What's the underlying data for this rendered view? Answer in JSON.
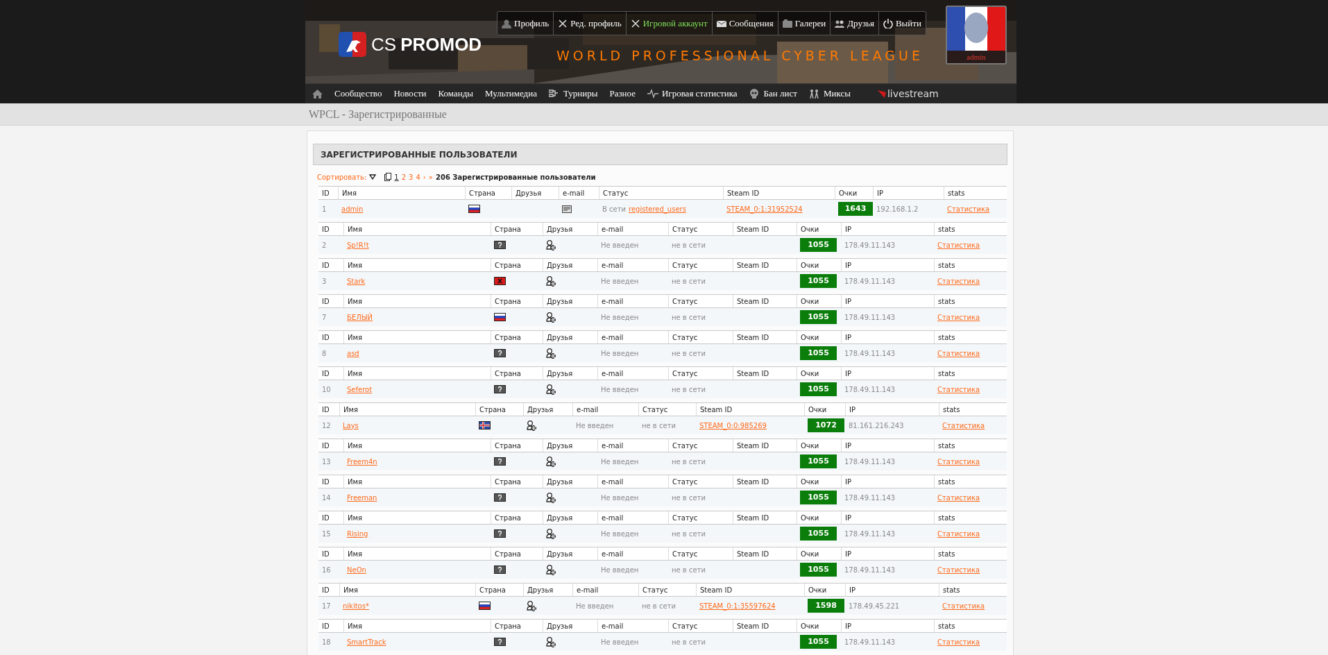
{
  "header": {
    "logo_prefix": "CS",
    "logo_name": "PROMOD",
    "tagline": "WORLD PROFESSIONAL CYBER LEAGUE",
    "avatar_name": "admin",
    "user_menu": [
      {
        "label": "Профиль",
        "selected": false
      },
      {
        "label": "Ред. профиль",
        "selected": false
      },
      {
        "label": "Игровой аккаунт",
        "selected": true
      },
      {
        "label": "Сообщения",
        "selected": false
      },
      {
        "label": "Галереи",
        "selected": false
      },
      {
        "label": "Друзья",
        "selected": false
      },
      {
        "label": "Выйти",
        "selected": false
      }
    ]
  },
  "nav": [
    {
      "kind": "home"
    },
    {
      "kind": "plain",
      "label": "Сообщество"
    },
    {
      "kind": "plain",
      "label": "Новости"
    },
    {
      "kind": "plain",
      "label": "Команды"
    },
    {
      "kind": "plain",
      "label": "Мультимедиа"
    },
    {
      "kind": "iconed",
      "label": "Турниры"
    },
    {
      "kind": "plain",
      "label": "Разное"
    },
    {
      "kind": "iconed",
      "label": "Игровая статистика"
    },
    {
      "kind": "iconed",
      "label": "Бан лист"
    },
    {
      "kind": "iconed",
      "label": "Миксы"
    },
    {
      "kind": "brand",
      "label": "livestream"
    }
  ],
  "breadcrumb": "WPCL - Зарегистрированные",
  "panel_title": "ЗАРЕГИСТРИРОВАННЫЕ ПОЛЬЗОВАТЕЛИ",
  "pager": {
    "sort_label": "Сортировать:",
    "pages": [
      {
        "label": "1",
        "selected": true
      },
      {
        "label": "2",
        "selected": false
      },
      {
        "label": "3",
        "selected": false
      },
      {
        "label": "4",
        "selected": false
      }
    ],
    "next": "›",
    "last": "»",
    "count_text": "206 Зарегистрированные пользователи"
  },
  "blocks": [
    {
      "kind": "online",
      "columns": [
        "ID",
        "Имя",
        "Страна",
        "Друзья",
        "e-mail",
        "Статус",
        "Steam ID",
        "Очки",
        "IP",
        "stats"
      ],
      "row": {
        "id": "1",
        "name": "admin",
        "flag": {
          "kind": "ru"
        },
        "friend_button": false,
        "status": "В сети",
        "group": "registered_users",
        "steam_id": "STEAM_0:1:31952524",
        "points": "1643",
        "ip": "192.168.1.2",
        "stats": "Статистика"
      }
    },
    {
      "kind": "basic",
      "columns": [
        "ID",
        "Имя",
        "Страна",
        "Друзья",
        "e-mail",
        "Статус",
        "Steam ID",
        "Очки",
        "IP",
        "stats"
      ],
      "row": {
        "id": "2",
        "name": "Sp!R!t",
        "flag": {
          "kind": "unknown"
        },
        "friend_button": true,
        "email": "Не введен",
        "status": "не в сети",
        "points": "1055",
        "ip": "178.49.11.143",
        "stats": "Статистика"
      }
    },
    {
      "kind": "basic",
      "columns": [
        "ID",
        "Имя",
        "Страна",
        "Друзья",
        "e-mail",
        "Статус",
        "Steam ID",
        "Очки",
        "IP",
        "stats"
      ],
      "row": {
        "id": "3",
        "name": "Stark",
        "flag": {
          "kind": "al"
        },
        "friend_button": true,
        "email": "Не введен",
        "status": "не в сети",
        "points": "1055",
        "ip": "178.49.11.143",
        "stats": "Статистика"
      }
    },
    {
      "kind": "basic",
      "columns": [
        "ID",
        "Имя",
        "Страна",
        "Друзья",
        "e-mail",
        "Статус",
        "Steam ID",
        "Очки",
        "IP",
        "stats"
      ],
      "row": {
        "id": "7",
        "name": "БЕЛЫЙ",
        "flag": {
          "kind": "ru"
        },
        "friend_button": true,
        "email": "Не введен",
        "status": "не в сети",
        "points": "1055",
        "ip": "178.49.11.143",
        "stats": "Статистика"
      }
    },
    {
      "kind": "basic",
      "columns": [
        "ID",
        "Имя",
        "Страна",
        "Друзья",
        "e-mail",
        "Статус",
        "Steam ID",
        "Очки",
        "IP",
        "stats"
      ],
      "row": {
        "id": "8",
        "name": "asd",
        "flag": {
          "kind": "unknown"
        },
        "friend_button": true,
        "email": "Не введен",
        "status": "не в сети",
        "points": "1055",
        "ip": "178.49.11.143",
        "stats": "Статистика"
      }
    },
    {
      "kind": "basic",
      "columns": [
        "ID",
        "Имя",
        "Страна",
        "Друзья",
        "e-mail",
        "Статус",
        "Steam ID",
        "Очки",
        "IP",
        "stats"
      ],
      "row": {
        "id": "10",
        "name": "Seferot",
        "flag": {
          "kind": "unknown"
        },
        "friend_button": true,
        "email": "Не введен",
        "status": "не в сети",
        "points": "1055",
        "ip": "178.49.11.143",
        "stats": "Статистика"
      }
    },
    {
      "kind": "steam",
      "columns": [
        "ID",
        "Имя",
        "Страна",
        "Друзья",
        "e-mail",
        "Статус",
        "Steam ID",
        "Очки",
        "IP",
        "stats"
      ],
      "row": {
        "id": "12",
        "name": "Lays",
        "flag": {
          "kind": "is"
        },
        "friend_button": true,
        "email": "Не введен",
        "status": "не в сети",
        "steam_id": "STEAM_0:0:985269",
        "points": "1072",
        "ip": "81.161.216.243",
        "stats": "Статистика"
      }
    },
    {
      "kind": "basic",
      "columns": [
        "ID",
        "Имя",
        "Страна",
        "Друзья",
        "e-mail",
        "Статус",
        "Steam ID",
        "Очки",
        "IP",
        "stats"
      ],
      "row": {
        "id": "13",
        "name": "Freem4n",
        "flag": {
          "kind": "unknown"
        },
        "friend_button": true,
        "email": "Не введен",
        "status": "не в сети",
        "points": "1055",
        "ip": "178.49.11.143",
        "stats": "Статистика"
      }
    },
    {
      "kind": "basic",
      "columns": [
        "ID",
        "Имя",
        "Страна",
        "Друзья",
        "e-mail",
        "Статус",
        "Steam ID",
        "Очки",
        "IP",
        "stats"
      ],
      "row": {
        "id": "14",
        "name": "Freeman",
        "flag": {
          "kind": "unknown"
        },
        "friend_button": true,
        "email": "Не введен",
        "status": "не в сети",
        "points": "1055",
        "ip": "178.49.11.143",
        "stats": "Статистика"
      }
    },
    {
      "kind": "basic",
      "columns": [
        "ID",
        "Имя",
        "Страна",
        "Друзья",
        "e-mail",
        "Статус",
        "Steam ID",
        "Очки",
        "IP",
        "stats"
      ],
      "row": {
        "id": "15",
        "name": "Rising",
        "flag": {
          "kind": "unknown"
        },
        "friend_button": true,
        "email": "Не введен",
        "status": "не в сети",
        "points": "1055",
        "ip": "178.49.11.143",
        "stats": "Статистика"
      }
    },
    {
      "kind": "basic",
      "columns": [
        "ID",
        "Имя",
        "Страна",
        "Друзья",
        "e-mail",
        "Статус",
        "Steam ID",
        "Очки",
        "IP",
        "stats"
      ],
      "row": {
        "id": "16",
        "name": "NeOn",
        "flag": {
          "kind": "unknown"
        },
        "friend_button": true,
        "email": "Не введен",
        "status": "не в сети",
        "points": "1055",
        "ip": "178.49.11.143",
        "stats": "Статистика"
      }
    },
    {
      "kind": "steam",
      "columns": [
        "ID",
        "Имя",
        "Страна",
        "Друзья",
        "e-mail",
        "Статус",
        "Steam ID",
        "Очки",
        "IP",
        "stats"
      ],
      "row": {
        "id": "17",
        "name": "nikitos*",
        "flag": {
          "kind": "ru"
        },
        "friend_button": true,
        "email": "Не введен",
        "status": "не в сети",
        "steam_id": "STEAM_0:1:35597624",
        "points": "1598",
        "ip": "178.49.45.221",
        "stats": "Статистика"
      }
    },
    {
      "kind": "basic",
      "columns": [
        "ID",
        "Имя",
        "Страна",
        "Друзья",
        "e-mail",
        "Статус",
        "Steam ID",
        "Очки",
        "IP",
        "stats"
      ],
      "row": {
        "id": "18",
        "name": "SmartTrack",
        "flag": {
          "kind": "unknown"
        },
        "friend_button": true,
        "email": "Не введен",
        "status": "не в сети",
        "points": "1055",
        "ip": "178.49.11.143",
        "stats": "Статистика"
      }
    }
  ]
}
